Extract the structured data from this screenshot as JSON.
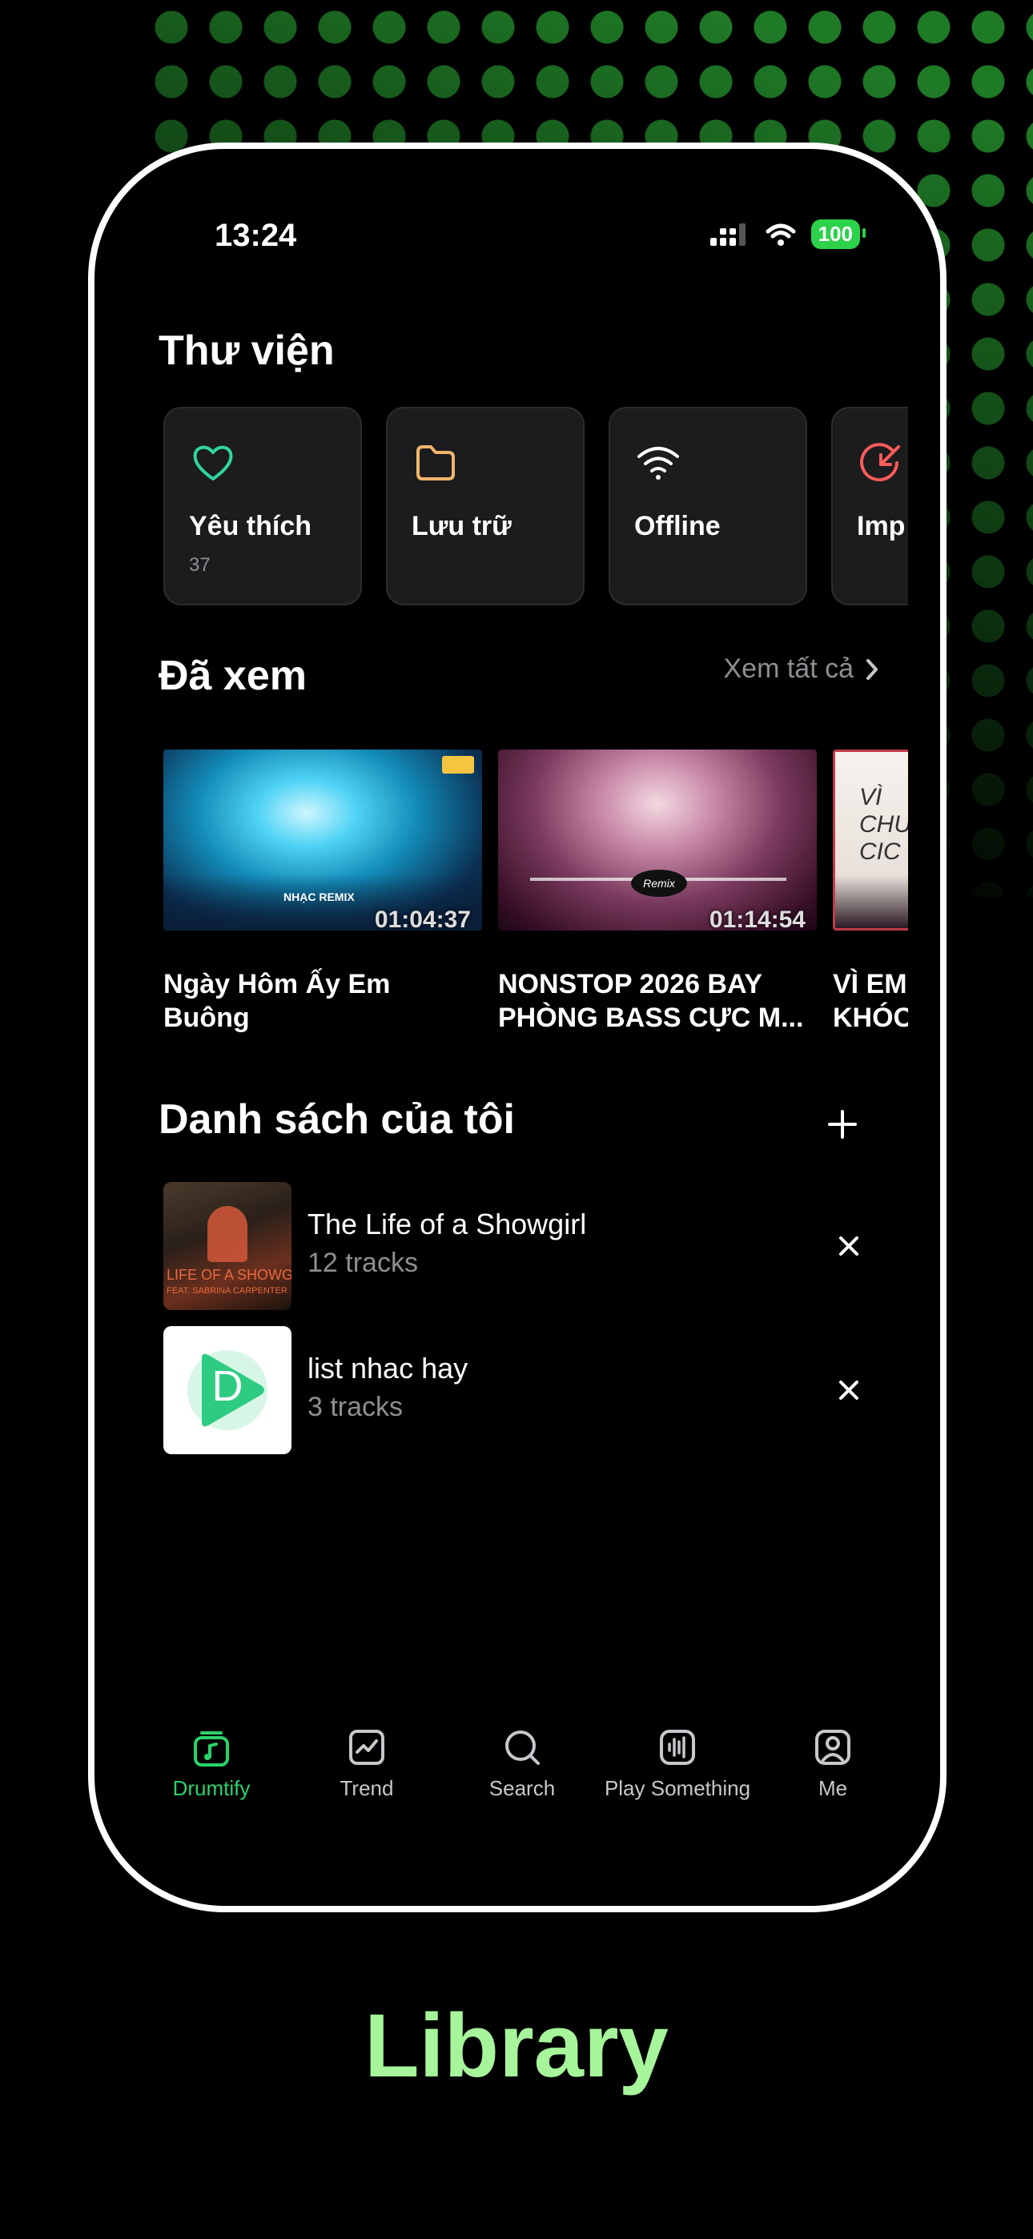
{
  "status": {
    "time": "13:24",
    "battery": "100"
  },
  "library": {
    "title": "Thư viện",
    "cards": [
      {
        "label": "Yêu thích",
        "sub": "37",
        "icon": "heart-icon"
      },
      {
        "label": "Lưu trữ",
        "sub": "",
        "icon": "folder-icon"
      },
      {
        "label": "Offline",
        "sub": "",
        "icon": "wifi-icon"
      },
      {
        "label": "Imp",
        "sub": "",
        "icon": "import-icon"
      }
    ]
  },
  "watched": {
    "title": "Đã xem",
    "see_all": "Xem tất cả",
    "videos": [
      {
        "title": "Ngày Hôm Ấy Em Buông\nTay Anh Vì Lý Do Gì Re...",
        "duration": "01:04:37",
        "badge": "NHẠC REMIX"
      },
      {
        "title": "NONSTOP 2026 BAY\nPHÒNG BASS CỰC M...",
        "duration": "01:14:54",
        "badge": "Remix"
      },
      {
        "title": "VÌ EM\nKHÓC",
        "duration": "",
        "badge": "VÌ CHƯ CIC"
      }
    ]
  },
  "playlists": {
    "title": "Danh sách của tôi",
    "items": [
      {
        "name": "The Life of a Showgirl",
        "count": "12 tracks",
        "art_text": "LIFE OF A SHOWG",
        "art_sub": "FEAT. SABRINA CARPENTER"
      },
      {
        "name": "list nhac hay",
        "count": "3 tracks",
        "art_text": "D"
      }
    ]
  },
  "tabs": [
    {
      "label": "Drumtify",
      "icon": "drumtify-icon",
      "active": true
    },
    {
      "label": "Trend",
      "icon": "trend-icon"
    },
    {
      "label": "Search",
      "icon": "search-icon"
    },
    {
      "label": "Play Something",
      "icon": "waveform-icon"
    },
    {
      "label": "Me",
      "icon": "profile-icon"
    }
  ],
  "caption": "Library",
  "colors": {
    "accent": "#2bd26b",
    "caption": "#a6f59a",
    "card_bg": "#1c1c1e",
    "battery": "#2bd24a"
  }
}
